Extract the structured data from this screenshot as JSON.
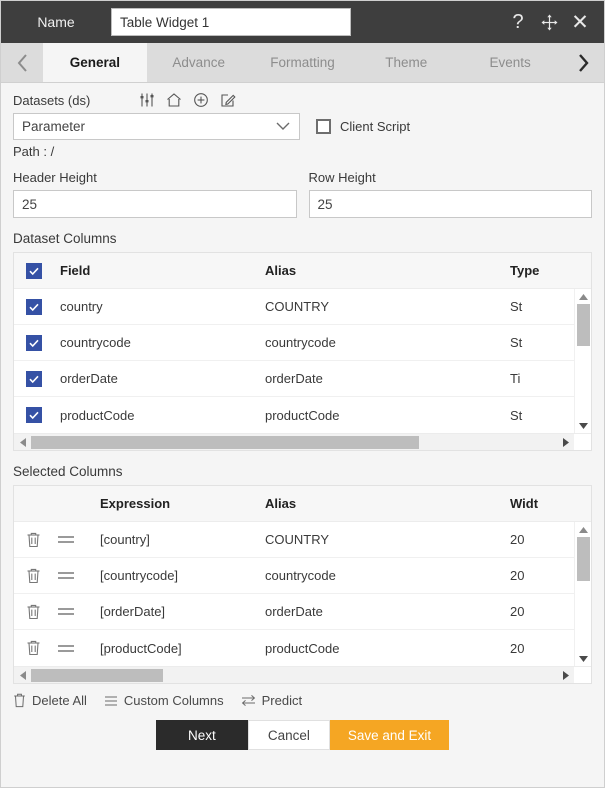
{
  "titlebar": {
    "name_label": "Name",
    "name_value": "Table Widget 1",
    "help_icon": "question-mark-icon",
    "move_icon": "move-icon",
    "close_icon": "close-icon"
  },
  "tabbar": {
    "prev_icon": "chevron-left-icon",
    "next_icon": "chevron-right-icon",
    "tabs": [
      {
        "label": "General",
        "active": true
      },
      {
        "label": "Advance",
        "active": false
      },
      {
        "label": "Formatting",
        "active": false
      },
      {
        "label": "Theme",
        "active": false
      },
      {
        "label": "Events",
        "active": false
      }
    ]
  },
  "datasets": {
    "label": "Datasets (ds)",
    "icons": [
      "sliders-icon",
      "home-icon",
      "plus-circle-icon",
      "edit-icon"
    ],
    "selected": "Parameter",
    "dropdown_icon": "chevron-down-icon",
    "client_script_label": "Client Script",
    "client_script_checked": false,
    "path_label": "Path :",
    "path_value": "/"
  },
  "heights": {
    "header_height_label": "Header Height",
    "header_height_value": "25",
    "row_height_label": "Row Height",
    "row_height_value": "25"
  },
  "dataset_columns": {
    "section_label": "Dataset Columns",
    "header": {
      "field": "Field",
      "alias": "Alias",
      "type": "Type",
      "select_all_checked": true
    },
    "rows": [
      {
        "checked": true,
        "field": "country",
        "alias": "COUNTRY",
        "type": "St"
      },
      {
        "checked": true,
        "field": "countrycode",
        "alias": "countrycode",
        "type": "St"
      },
      {
        "checked": true,
        "field": "orderDate",
        "alias": "orderDate",
        "type": "Ti"
      },
      {
        "checked": true,
        "field": "productCode",
        "alias": "productCode",
        "type": "St"
      }
    ]
  },
  "selected_columns": {
    "section_label": "Selected Columns",
    "header": {
      "expression": "Expression",
      "alias": "Alias",
      "width": "Widt"
    },
    "rows": [
      {
        "expression": "[country]",
        "alias": "COUNTRY",
        "width": "20"
      },
      {
        "expression": "[countrycode]",
        "alias": "countrycode",
        "width": "20"
      },
      {
        "expression": "[orderDate]",
        "alias": "orderDate",
        "width": "20"
      },
      {
        "expression": "[productCode]",
        "alias": "productCode",
        "width": "20"
      }
    ]
  },
  "footer": {
    "actions": [
      {
        "label": "Delete All",
        "icon": "trash-icon"
      },
      {
        "label": "Custom Columns",
        "icon": "hamburger-icon"
      },
      {
        "label": "Predict",
        "icon": "swap-arrows-icon"
      }
    ],
    "buttons": {
      "next": "Next",
      "cancel": "Cancel",
      "save": "Save and Exit"
    }
  },
  "colors": {
    "titlebar_bg": "#3e3e3e",
    "tabbar_bg": "#dcdcdc",
    "checkbox_blue": "#3551a5",
    "save_orange": "#f5a623",
    "next_dark": "#2b2b2b"
  }
}
